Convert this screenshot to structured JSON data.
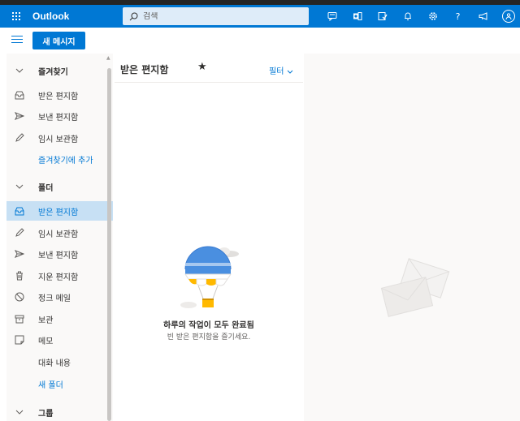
{
  "app": {
    "title": "Outlook"
  },
  "search": {
    "placeholder": "검색"
  },
  "header": {
    "icons": [
      "chat-icon",
      "office-icon",
      "checklist-icon",
      "bell-icon",
      "gear-icon",
      "help-icon",
      "megaphone-icon"
    ],
    "help_glyph": "?"
  },
  "toolbar": {
    "new_mail_label": "새 메시지"
  },
  "sidebar": {
    "favorites_header": "즐겨찾기",
    "favorites": [
      {
        "label": "받은 편지함",
        "icon": "inbox-icon"
      },
      {
        "label": "보낸 편지함",
        "icon": "send-icon"
      },
      {
        "label": "임시 보관함",
        "icon": "pencil-icon"
      }
    ],
    "add_favorite": "즐겨찾기에 추가",
    "folders_header": "폴더",
    "folders": [
      {
        "label": "받은 편지함",
        "icon": "inbox-icon",
        "selected": true
      },
      {
        "label": "임시 보관함",
        "icon": "pencil-icon"
      },
      {
        "label": "보낸 편지함",
        "icon": "send-icon"
      },
      {
        "label": "지운 편지함",
        "icon": "trash-icon"
      },
      {
        "label": "정크 메일",
        "icon": "block-icon"
      },
      {
        "label": "보관",
        "icon": "archive-icon"
      },
      {
        "label": "메모",
        "icon": "note-icon"
      },
      {
        "label": "대화 내용",
        "icon": ""
      }
    ],
    "new_folder": "새 폴더",
    "groups_header": "그룹"
  },
  "message_list": {
    "title": "받은 편지함",
    "star": "★",
    "filter_label": "필터",
    "empty_title": "하루의 작업이 모두 완료됨",
    "empty_subtitle": "빈 받은 편지함을 즐기세요."
  },
  "colors": {
    "accent": "#0078d4",
    "selected_bg": "#c7e0f4",
    "sidebar_bg": "#faf9f8"
  }
}
